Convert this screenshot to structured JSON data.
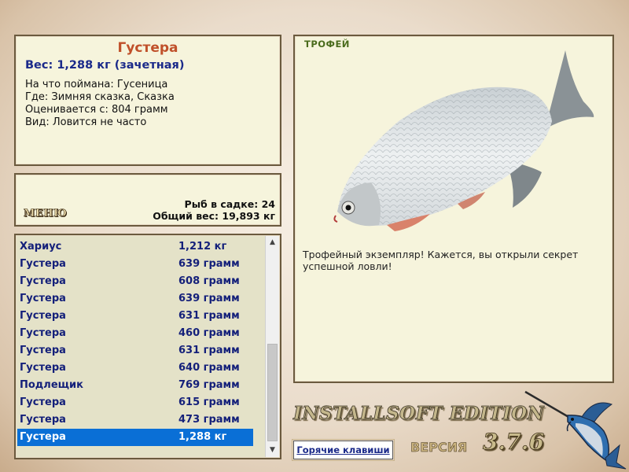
{
  "fish_info": {
    "name": "Густера",
    "weight": "Вес: 1,288 кг (зачетная)",
    "lines": [
      "На что поймана: Гусеница",
      "Где: Зимняя сказка, Сказка",
      "Оценивается с: 804 грамм",
      "Вид: Ловится не часто"
    ]
  },
  "summary": {
    "menu_label": "МЕНЮ",
    "fish_count": "Рыб в садке: 24",
    "total_weight": "Общий вес: 19,893 кг"
  },
  "catch_list": {
    "rows": [
      {
        "name": "Хариус",
        "weight": "1,212 кг"
      },
      {
        "name": "Густера",
        "weight": "639 грамм"
      },
      {
        "name": "Густера",
        "weight": "608 грамм"
      },
      {
        "name": "Густера",
        "weight": "639 грамм"
      },
      {
        "name": "Густера",
        "weight": "631 грамм"
      },
      {
        "name": "Густера",
        "weight": "460 грамм"
      },
      {
        "name": "Густера",
        "weight": "631 грамм"
      },
      {
        "name": "Густера",
        "weight": "640 грамм"
      },
      {
        "name": "Подлещик",
        "weight": "769 грамм"
      },
      {
        "name": "Густера",
        "weight": "615 грамм"
      },
      {
        "name": "Густера",
        "weight": "473 грамм"
      },
      {
        "name": "Густера",
        "weight": "1,288 кг",
        "selected": true
      }
    ],
    "scroll_up_icon": "triangle-up",
    "scroll_down_icon": "triangle-down"
  },
  "trophy": {
    "label": "ТРОФЕЙ",
    "description": "Трофейный экземпляр! Кажется, вы открыли секрет успешной ловли!"
  },
  "footer": {
    "hotkeys": "Горячие клавиши",
    "edition": "INSTALLSOFT EDITION",
    "version_label": "ВЕРСИЯ",
    "version_number": "3.7.6"
  },
  "colors": {
    "panel_bg": "#f6f4dc",
    "list_text": "#14207a",
    "selection": "#0a6fd6",
    "fish_name": "#c0502a"
  }
}
